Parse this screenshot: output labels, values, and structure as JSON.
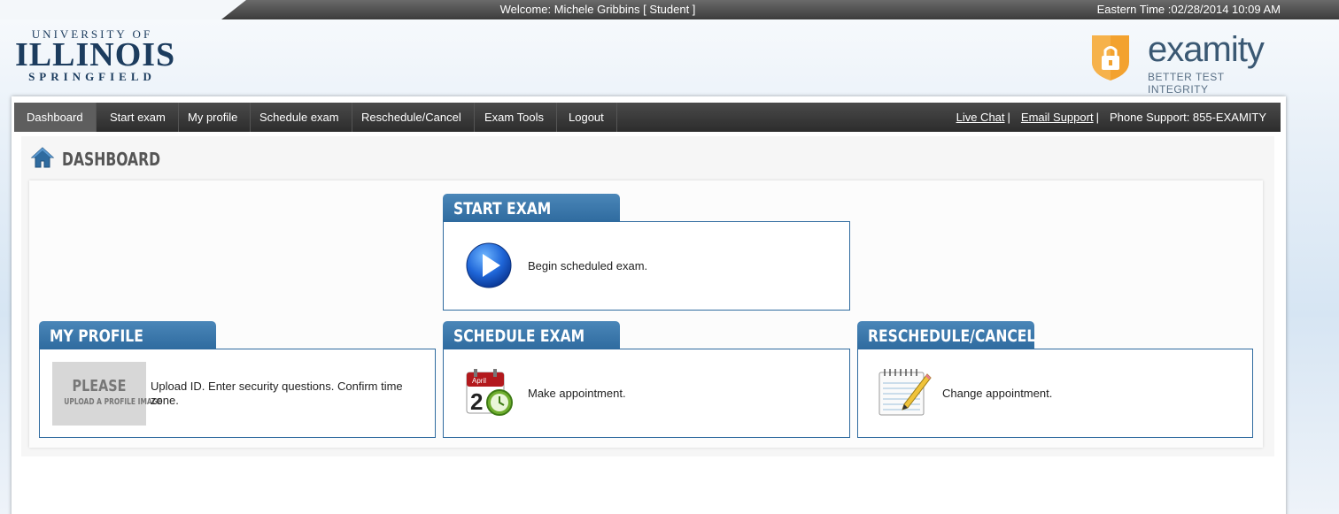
{
  "topbar": {
    "welcome": "Welcome: Michele Gribbins [ Student ]",
    "time": "Eastern Time :02/28/2014 10:09 AM"
  },
  "logo_uis": {
    "line1": "UNIVERSITY OF",
    "line2": "ILLINOIS",
    "line3": "SPRINGFIELD"
  },
  "logo_examity": {
    "brand": "examity",
    "tagline": "BETTER TEST INTEGRITY"
  },
  "nav": {
    "items": [
      {
        "label": "Dashboard",
        "active": true
      },
      {
        "label": "Start exam"
      },
      {
        "label": "My profile"
      },
      {
        "label": "Schedule exam"
      },
      {
        "label": "Reschedule/Cancel"
      },
      {
        "label": "Exam Tools"
      },
      {
        "label": "Logout"
      }
    ],
    "live_chat": "Live Chat",
    "email_support": "Email Support",
    "sep": "|",
    "phone": "Phone Support: 855-EXAMITY"
  },
  "page_title": "DASHBOARD",
  "cards": {
    "start_exam": {
      "title": "START EXAM",
      "text": "Begin scheduled exam."
    },
    "my_profile": {
      "title": "MY PROFILE",
      "text": "Upload ID. Enter security questions. Confirm time zone.",
      "img_line1": "PLEASE",
      "img_line2": "UPLOAD A PROFILE IMAGE"
    },
    "schedule_exam": {
      "title": "SCHEDULE EXAM",
      "text": "Make appointment.",
      "cal_month": "April",
      "cal_day": "2"
    },
    "reschedule": {
      "title": "RESCHEDULE/CANCEL",
      "text": "Change appointment."
    }
  },
  "colors": {
    "accent": "#3a78ad",
    "navbar": "#333333",
    "topbar": "#4a4a4a"
  }
}
